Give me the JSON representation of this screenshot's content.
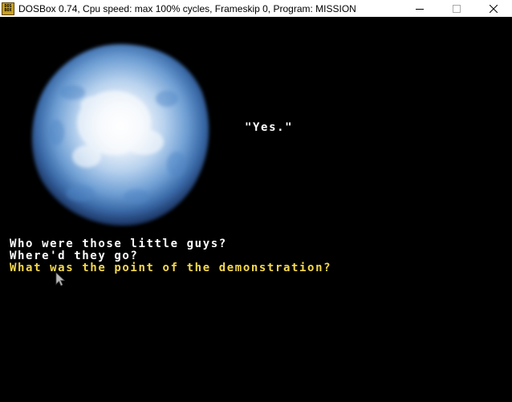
{
  "window": {
    "title": "DOSBox 0.74, Cpu speed: max 100% cycles, Frameskip  0, Program:  MISSION",
    "icon_text_top": "DOS",
    "icon_text_bottom": "BOX",
    "controls": {
      "minimize": "minimize-icon",
      "maximize": "maximize-icon",
      "close": "close-icon"
    }
  },
  "game": {
    "speech": "\"Yes.\"",
    "dialog_options": [
      "Who were those little guys?",
      "Where'd they go?",
      "What was the point of the demonstration?"
    ],
    "colors": {
      "background": "#000000",
      "option_normal": "#ffffff",
      "option_highlight": "#f4d84c",
      "orb_glow": "#a8c8ec"
    }
  }
}
